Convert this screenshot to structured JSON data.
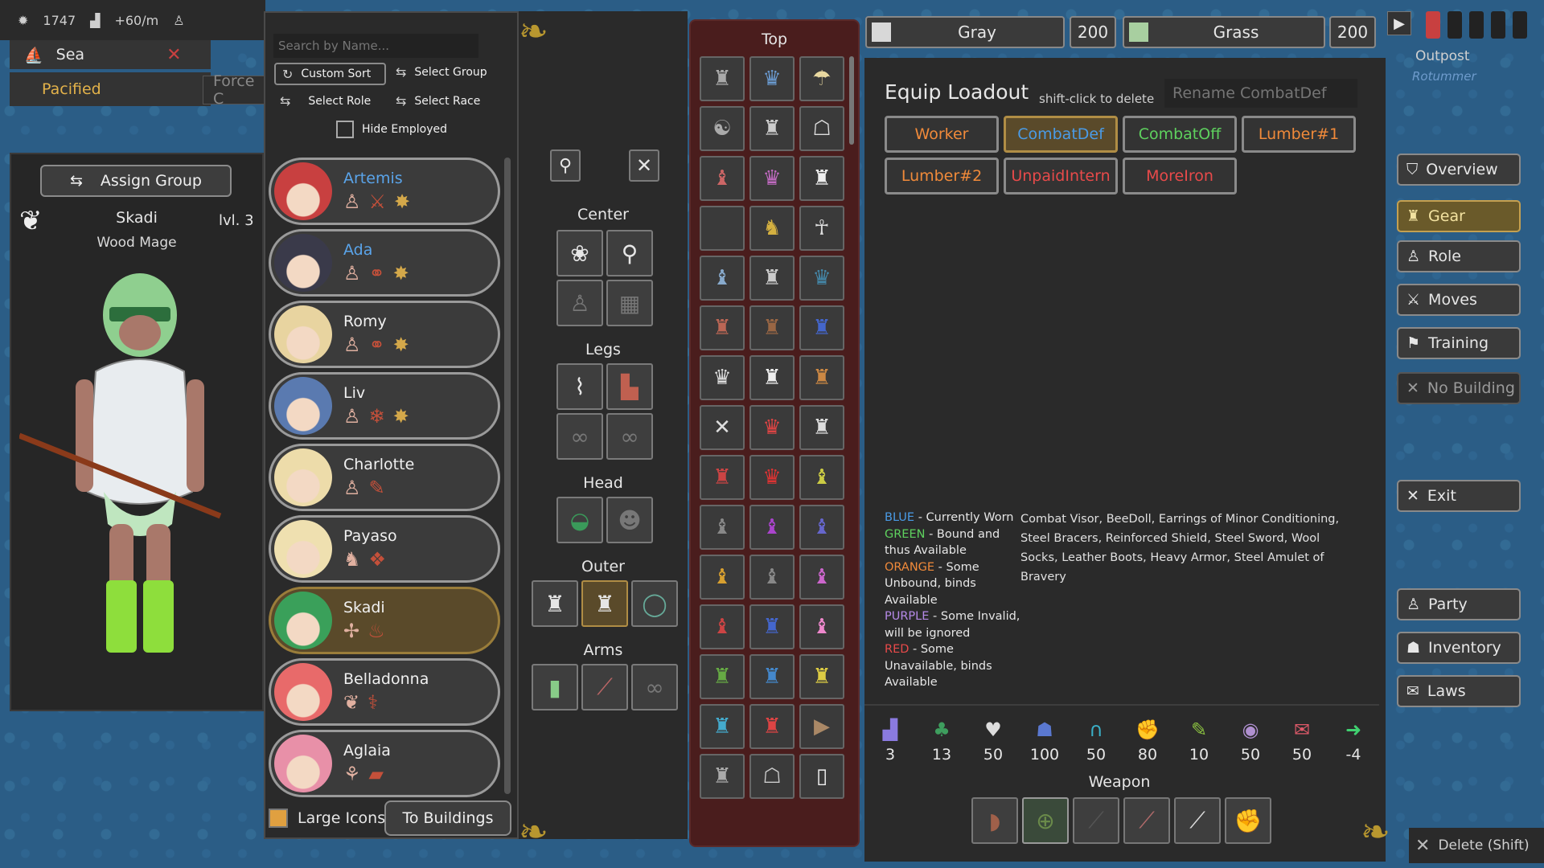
{
  "hud": {
    "day": "1747",
    "income": "+60/m",
    "region": "Sea",
    "status": "Pacified",
    "force_label": "Force C"
  },
  "character": {
    "assign_group_label": "Assign Group",
    "name": "Skadi",
    "level": "lvl. 3",
    "class": "Wood Mage"
  },
  "roster": {
    "search_placeholder": "Search by Name...",
    "custom_sort_label": "Custom Sort",
    "select_group_label": "Select Group",
    "select_role_label": "Select Role",
    "select_race_label": "Select Race",
    "hide_employed_label": "Hide Employed",
    "members": [
      {
        "name": "Artemis",
        "color": "#5aa4ea",
        "icons": [
          "♙",
          "⚔",
          "✸"
        ]
      },
      {
        "name": "Ada",
        "color": "#5aa4ea",
        "icons": [
          "♙",
          "⚭",
          "✸"
        ]
      },
      {
        "name": "Romy",
        "color": "#f0f0f0",
        "icons": [
          "♙",
          "⚭",
          "✸"
        ]
      },
      {
        "name": "Liv",
        "color": "#f0f0f0",
        "icons": [
          "♙",
          "❄",
          "✸"
        ]
      },
      {
        "name": "Charlotte",
        "color": "#f0f0f0",
        "icons": [
          "♙",
          "✎"
        ]
      },
      {
        "name": "Payaso",
        "color": "#f0f0f0",
        "icons": [
          "♞",
          "❖"
        ]
      },
      {
        "name": "Skadi",
        "color": "#f0f0f0",
        "icons": [
          "✢",
          "♨"
        ]
      },
      {
        "name": "Belladonna",
        "color": "#f0f0f0",
        "icons": [
          "❦",
          "⚕"
        ]
      },
      {
        "name": "Aglaia",
        "color": "#f0f0f0",
        "icons": [
          "⚘",
          "▰"
        ]
      }
    ],
    "large_icons_label": "Large Icons",
    "to_buildings_label": "To Buildings"
  },
  "slots": {
    "center_label": "Center",
    "legs_label": "Legs",
    "head_label": "Head",
    "outer_label": "Outer",
    "arms_label": "Arms"
  },
  "items": {
    "title": "Top"
  },
  "materials": {
    "primary": {
      "name": "Gray",
      "count": "200",
      "color": "#d8d8d8"
    },
    "secondary": {
      "name": "Grass",
      "count": "200",
      "color": "#a8cfa0"
    }
  },
  "loadout": {
    "title": "Equip Loadout",
    "hint": "shift-click to delete",
    "rename_placeholder": "Rename CombatDef",
    "buttons": [
      {
        "label": "Worker",
        "color": "#f08a3a"
      },
      {
        "label": "CombatDef",
        "color": "#4a9be6"
      },
      {
        "label": "CombatOff",
        "color": "#5ed15e"
      },
      {
        "label": "Lumber#1",
        "color": "#f08a3a"
      },
      {
        "label": "Lumber#2",
        "color": "#f08a3a"
      },
      {
        "label": "UnpaidIntern",
        "color": "#e84a4a"
      },
      {
        "label": "MoreIron",
        "color": "#e84a4a"
      }
    ],
    "legend": {
      "blue_key": "BLUE",
      "blue_text": " - Currently Worn",
      "green_key": "GREEN",
      "green_text": " - Bound and thus Available",
      "orange_key": "ORANGE",
      "orange_text": " - Some Unbound, binds Available",
      "purple_key": "PURPLE",
      "purple_text": " - Some Invalid, will be ignored",
      "red_key": "RED",
      "red_text": " - Some Unavailable, binds Available"
    },
    "worn_items": "Combat Visor, BeeDoll, Earrings of Minor Conditioning, Steel Bracers, Reinforced Shield, Steel Sword, Wool Socks, Leather Boots, Heavy Armor, Steel Amulet of Bravery",
    "stats": [
      {
        "icon": "signal-icon",
        "glyph": "▟",
        "value": "3",
        "color": "#8a7ae0"
      },
      {
        "icon": "clover-icon",
        "glyph": "♣",
        "value": "13",
        "color": "#3e9e5e"
      },
      {
        "icon": "heart-shield-icon",
        "glyph": "♥",
        "value": "50",
        "color": "#dddddd"
      },
      {
        "icon": "spirit-icon",
        "glyph": "☗",
        "value": "100",
        "color": "#5a78d0"
      },
      {
        "icon": "headphones-icon",
        "glyph": "∩",
        "value": "50",
        "color": "#3ab0c8"
      },
      {
        "icon": "fist-icon",
        "glyph": "✊",
        "value": "80",
        "color": "#e88a30"
      },
      {
        "icon": "feather-icon",
        "glyph": "✎",
        "value": "10",
        "color": "#8ac040"
      },
      {
        "icon": "eye-icon",
        "glyph": "◉",
        "value": "50",
        "color": "#b090d0"
      },
      {
        "icon": "speech-icon",
        "glyph": "✉",
        "value": "50",
        "color": "#e05a6a"
      },
      {
        "icon": "arrow-right-icon",
        "glyph": "➜",
        "value": "-4",
        "color": "#40d070"
      }
    ],
    "weapon_label": "Weapon"
  },
  "nav": {
    "outpost": "Outpost",
    "outpost_sub": "Rotummer",
    "overview": "Overview",
    "gear": "Gear",
    "role": "Role",
    "moves": "Moves",
    "training": "Training",
    "no_building": "No Building",
    "exit": "Exit",
    "party": "Party",
    "inventory": "Inventory",
    "laws": "Laws",
    "delete_shift": "Delete (Shift)"
  }
}
